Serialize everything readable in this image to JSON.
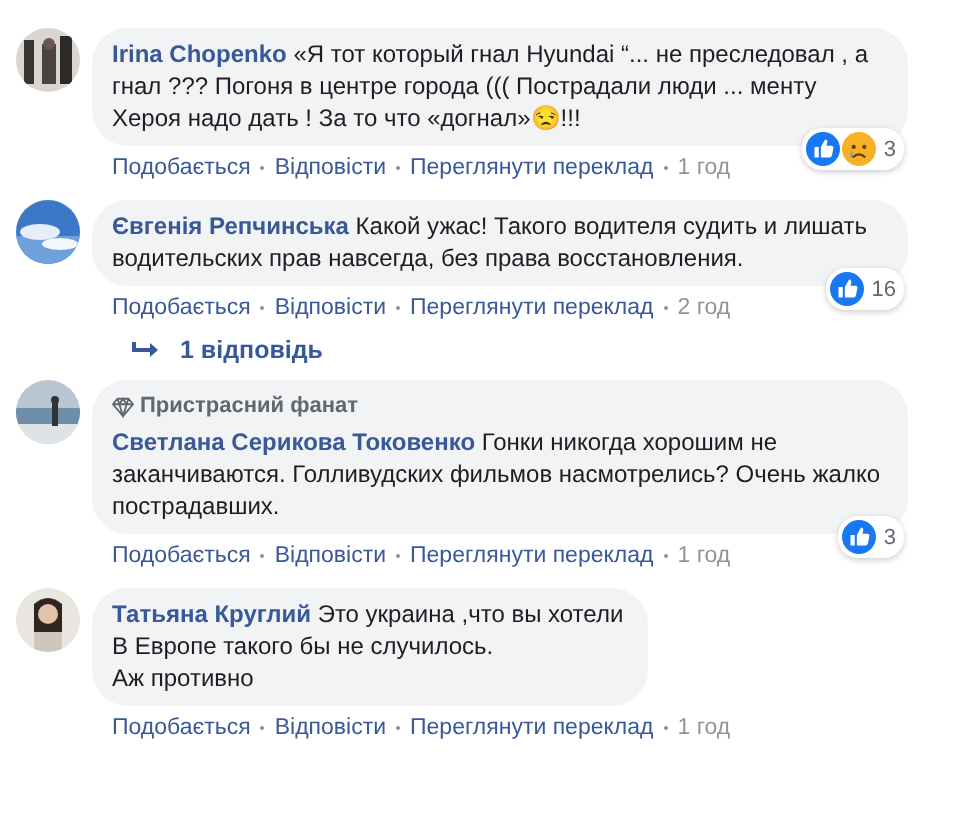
{
  "comments": [
    {
      "author": "Irina Chopenko",
      "text": "«Я тот который гнал Hyundai “... не преследовал , а гнал ??? Погоня в центре города ((( Пострадали люди ... менту Хероя надо дать ! За то что «догнал»😒!!!",
      "reactions": [
        {
          "kind": "like"
        },
        {
          "kind": "sad"
        }
      ],
      "reaction_count": "3",
      "actions": [
        "Подобається",
        "Відповісти",
        "Переглянути переклад"
      ],
      "time": "1 год"
    },
    {
      "author": "Євгенія Репчинська",
      "text": "Какой ужас! Такого водителя судить и лишать водительских прав навсегда, без права восстановления.",
      "reactions": [
        {
          "kind": "like"
        }
      ],
      "reaction_count": "16",
      "actions": [
        "Подобається",
        "Відповісти",
        "Переглянути переклад"
      ],
      "time": "2 год",
      "replies": "1 відповідь"
    },
    {
      "author": "Светлана Серикова Токовенко",
      "badge": "Пристрасний фанат",
      "text": "Гонки никогда хорошим не заканчиваются. Голливудских фильмов насмотрелись? Очень жалко пострадавших.",
      "reactions": [
        {
          "kind": "like"
        }
      ],
      "reaction_count": "3",
      "actions": [
        "Подобається",
        "Відповісти",
        "Переглянути переклад"
      ],
      "time": "1 год"
    },
    {
      "author": "Татьяна Круглий",
      "text": "Это украина ,что вы хотели\nВ Европе такого бы не случилось.\nАж противно",
      "actions": [
        "Подобається",
        "Відповісти",
        "Переглянути переклад"
      ],
      "time": "1 год"
    }
  ]
}
